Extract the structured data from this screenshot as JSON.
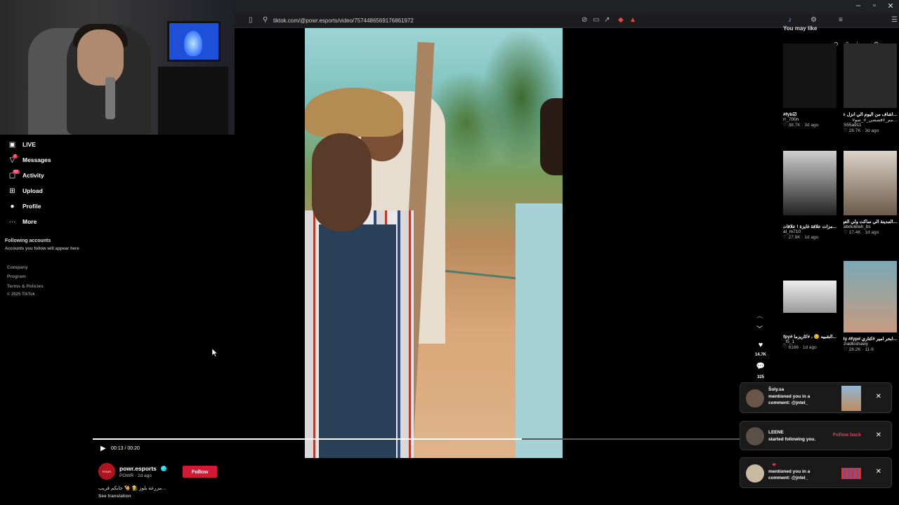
{
  "browser": {
    "url": "tiktok.com/@powr.esports/video/7574486569176861972",
    "window_controls": [
      "–",
      "▫",
      "✕"
    ]
  },
  "sidebar": {
    "items": [
      {
        "label": "LIVE",
        "icon": "live-icon"
      },
      {
        "label": "Messages",
        "icon": "messages-icon",
        "badge": "2"
      },
      {
        "label": "Activity",
        "icon": "activity-icon",
        "badge": "52"
      },
      {
        "label": "Upload",
        "icon": "upload-icon"
      },
      {
        "label": "Profile",
        "icon": "profile-icon"
      },
      {
        "label": "More",
        "icon": "more-icon"
      }
    ],
    "following_title": "Following accounts",
    "following_sub": "Accounts you follow will appear here",
    "footer": [
      "Company",
      "Program",
      "Terms & Policies",
      "© 2025 TikTok"
    ]
  },
  "player": {
    "time": "00:13 / 00:20",
    "progress_fraction": 0.65
  },
  "author": {
    "avatar_text": "POWR",
    "name": "powr.esports",
    "sub": "POWR · 2d ago",
    "follow_label": "Follow",
    "caption": "...مزرعة بلوز 🧑‍🌾 🐪 جايكم قريب",
    "see_translation": "See translation"
  },
  "actions": {
    "likes": "14.7K",
    "comments": "325"
  },
  "you_may_like": {
    "title": "You may like",
    "tiles": [
      {
        "t1": "#fyb☑",
        "t2": "rr_700n",
        "t3": "♡ 38.7K · 3d ago",
        "bg": "#141414"
      },
      {
        "t1": "...اشاف من اليوم الي انزل علاقتنا",
        "t2": "...مم_#قصصي_#_صو#",
        "t3": "S55a911",
        "t4": "♡ 28.7K · 3d ago",
        "bg": "#2a2a2a"
      },
      {
        "t1": "...مزات علاقة غايزة ! علاقات",
        "t2": "al_m710",
        "t3": "♡ 27.9K · 1d ago",
        "bg": "#9a9a9a"
      },
      {
        "t1": "...المدينة الي ساكت ولي العهد",
        "t2": "abdulelah_bs",
        "t3": "♡ 17.4K · 1d ago",
        "bg": "#c9b8a8"
      },
      {
        "t1": "...الشبيه 😊 ، #كاريزما #fyp #fpy",
        "t2": "_f5_1",
        "t3": "♡ 6166 · 1d ago",
        "bg": "#d9d9d9"
      },
      {
        "t1": "...ابحر امير #كتاري #comedy #fyp",
        "t2": "ziadkishawy",
        "t3": "♡ 28.2K · 11-9",
        "bg": "#4a7a8a"
      }
    ]
  },
  "notifications": [
    {
      "name": "Šoly.sa",
      "msg": "mentioned you in a comment: @jntel_",
      "type": "mention"
    },
    {
      "name": "LEENE",
      "msg": "started following you.",
      "action": "Follow back",
      "type": "follow"
    },
    {
      "name": "_ ❤",
      "msg": "mentioned you in a comment: @jntel_",
      "type": "mention"
    }
  ]
}
